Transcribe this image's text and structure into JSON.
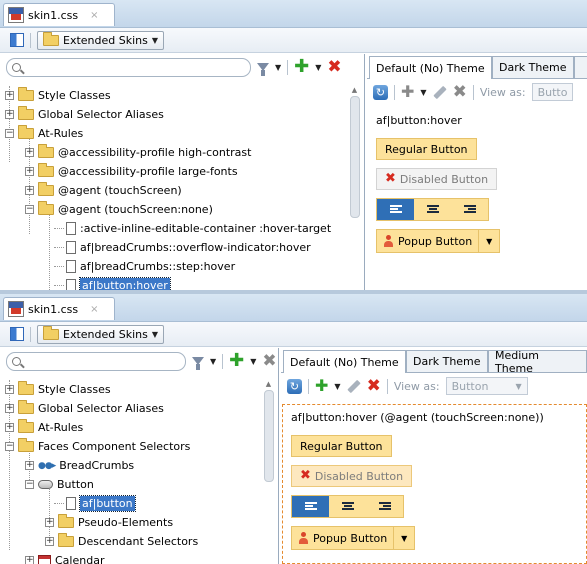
{
  "panel_top": {
    "file_tab": {
      "name": "skin1.css",
      "close": "×"
    },
    "toolbar": {
      "extended_skins": "Extended Skins"
    },
    "search": {
      "placeholder": ""
    },
    "tree": [
      {
        "label": "Style Classes",
        "icon": "folder-icon",
        "expander": "+"
      },
      {
        "label": "Global Selector Aliases",
        "icon": "folder-icon",
        "expander": "+"
      },
      {
        "label": "At-Rules",
        "icon": "folder-open-icon",
        "expander": "−"
      },
      {
        "label": "@accessibility-profile high-contrast",
        "icon": "folder-icon",
        "expander": "+"
      },
      {
        "label": "@accessibility-profile large-fonts",
        "icon": "folder-icon",
        "expander": "+"
      },
      {
        "label": "@agent (touchScreen)",
        "icon": "folder-icon",
        "expander": "+"
      },
      {
        "label": "@agent (touchScreen:none)",
        "icon": "folder-open-icon",
        "expander": "−"
      },
      {
        "label": ":active-inline-editable-container :hover-target",
        "icon": "page-icon"
      },
      {
        "label": "af|breadCrumbs::overflow-indicator:hover",
        "icon": "page-icon"
      },
      {
        "label": "af|breadCrumbs::step:hover",
        "icon": "page-icon"
      },
      {
        "label": "af|button:hover",
        "icon": "page-icon",
        "selected": true
      }
    ],
    "theme_tabs": [
      "Default (No) Theme",
      "Dark Theme"
    ],
    "view_as_label": "View as:",
    "view_as_value": "Butto",
    "preview_label": "af|button:hover",
    "buttons": {
      "regular": "Regular Button",
      "disabled": "Disabled Button",
      "popup": "Popup Button"
    }
  },
  "panel_bottom": {
    "file_tab": {
      "name": "skin1.css",
      "close": "×"
    },
    "toolbar": {
      "extended_skins": "Extended Skins"
    },
    "search": {
      "placeholder": ""
    },
    "tree": [
      {
        "label": "Style Classes",
        "icon": "folder-icon",
        "expander": "+"
      },
      {
        "label": "Global Selector Aliases",
        "icon": "folder-icon",
        "expander": "+"
      },
      {
        "label": "At-Rules",
        "icon": "folder-icon",
        "expander": "+"
      },
      {
        "label": "Faces Component Selectors",
        "icon": "folder-open-icon",
        "expander": "−"
      },
      {
        "label": "BreadCrumbs",
        "icon": "breadcrumbs-icon",
        "expander": "+"
      },
      {
        "label": "Button",
        "icon": "button-icon",
        "expander": "−"
      },
      {
        "label": "af|button",
        "icon": "page-icon",
        "selected": true
      },
      {
        "label": "Pseudo-Elements",
        "icon": "folder-icon",
        "expander": "+"
      },
      {
        "label": "Descendant Selectors",
        "icon": "folder-icon",
        "expander": "+"
      },
      {
        "label": "Calendar",
        "icon": "calendar-icon",
        "expander": "+"
      }
    ],
    "theme_tabs": [
      "Default (No) Theme",
      "Dark Theme",
      "Medium Theme"
    ],
    "view_as_label": "View as:",
    "view_as_value": "Button",
    "preview_label": "af|button:hover  (@agent (touchScreen:none))",
    "buttons": {
      "regular": "Regular Button",
      "disabled": "Disabled Button",
      "popup": "Popup Button"
    }
  }
}
